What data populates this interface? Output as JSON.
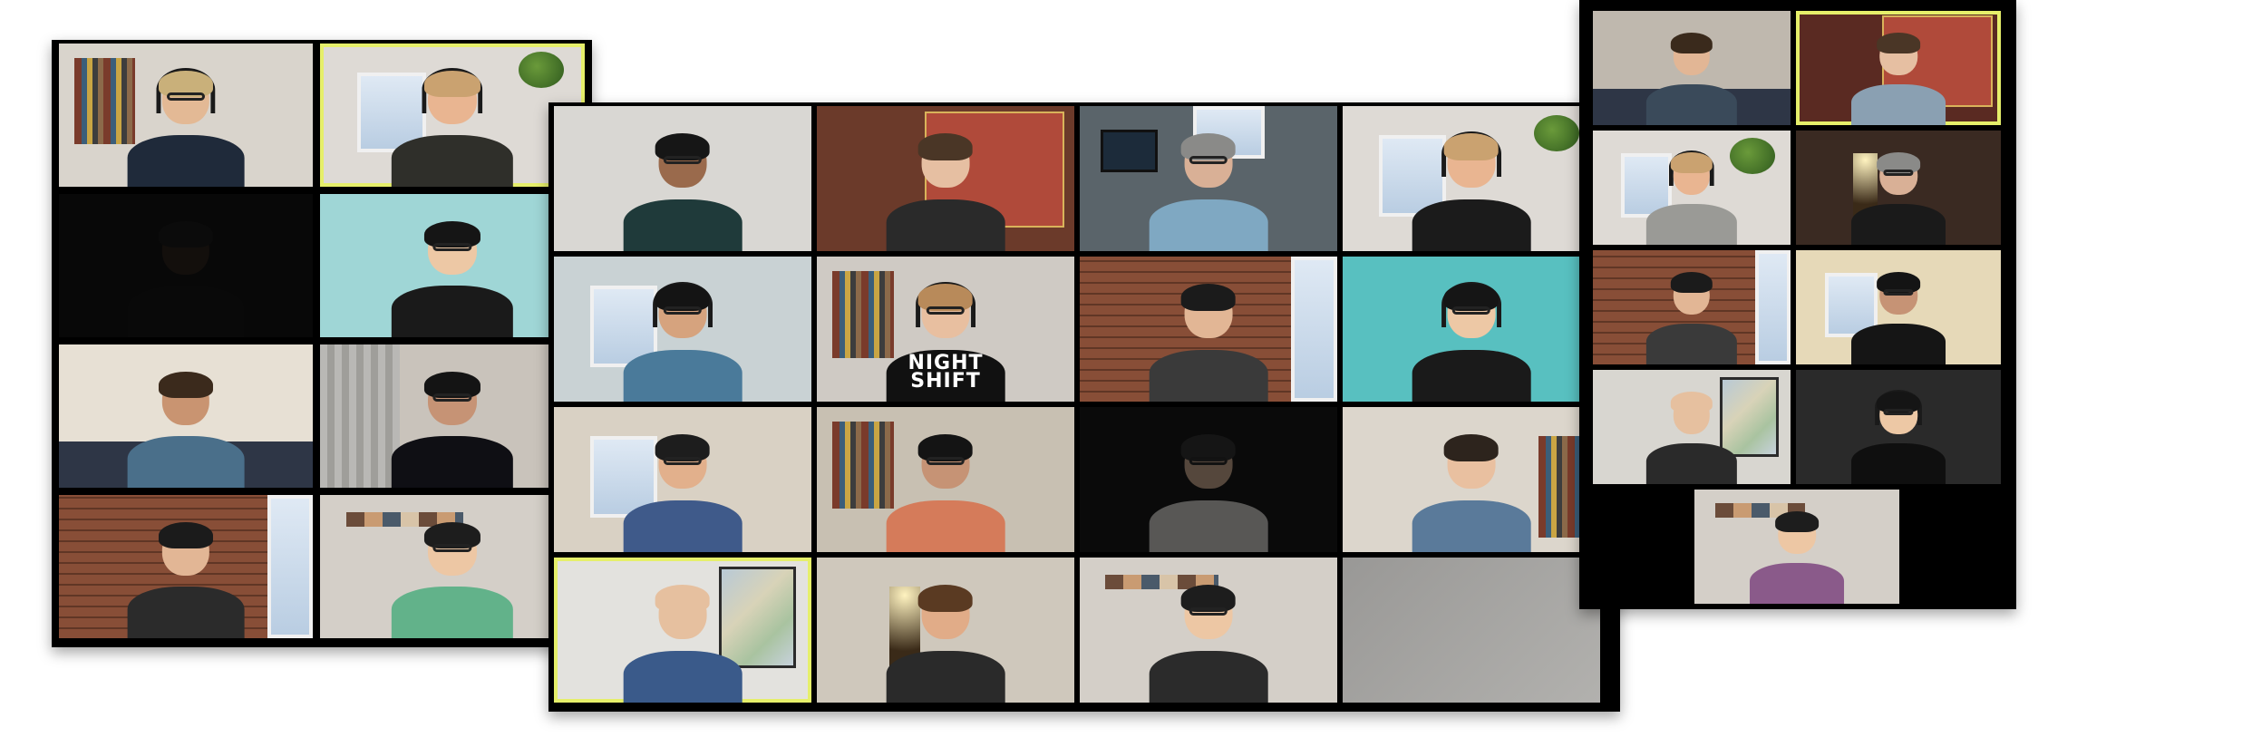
{
  "screen": {
    "background": "#ffffff"
  },
  "colors": {
    "window_bg": "#000000",
    "active_speaker_border": "#e6ef6a"
  },
  "windows": [
    {
      "name": "left-gallery",
      "tiles": [
        {
          "name": "participant-1",
          "bg": "#d9d4cc",
          "skin": "#e3b995",
          "hair": "#c9b07a",
          "shirt": "#1f2a3a",
          "glasses": true,
          "headset": true,
          "speaking": false,
          "scene": "room-shelf"
        },
        {
          "name": "participant-2",
          "bg": "#dedad5",
          "skin": "#e9b591",
          "hair": "#caa270",
          "shirt": "#2f2f2a",
          "glasses": false,
          "headset": true,
          "speaking": true,
          "scene": "window-plant"
        },
        {
          "name": "participant-3",
          "bg": "#080808",
          "skin": "#2a1c14",
          "hair": "#111111",
          "shirt": "#0c0c0c",
          "glasses": false,
          "headset": false,
          "speaking": false,
          "scene": "dark"
        },
        {
          "name": "participant-4",
          "bg": "#9fd6d6",
          "skin": "#edc8a5",
          "hair": "#151515",
          "shirt": "#1a1a1a",
          "glasses": true,
          "headset": false,
          "speaking": false,
          "scene": "plain"
        },
        {
          "name": "participant-5",
          "bg": "#e7e0d4",
          "skin": "#c99471",
          "hair": "#3b2a1c",
          "shirt": "#4a6f8a",
          "glasses": false,
          "headset": false,
          "speaking": false,
          "scene": "couch"
        },
        {
          "name": "participant-6",
          "bg": "#c9c3bb",
          "skin": "#c69375",
          "hair": "#141414",
          "shirt": "#0f0f14",
          "glasses": true,
          "headset": false,
          "speaking": false,
          "scene": "curtain"
        },
        {
          "name": "participant-7",
          "bg": "#7a4a34",
          "skin": "#e2b695",
          "hair": "#1b1b1b",
          "shirt": "#2b2b2b",
          "glasses": false,
          "headset": false,
          "speaking": false,
          "scene": "brick"
        },
        {
          "name": "participant-8",
          "bg": "#d4cfc8",
          "skin": "#edc7a4",
          "hair": "#1d1d1d",
          "shirt": "#62b28a",
          "glasses": true,
          "headset": false,
          "speaking": false,
          "scene": "photos"
        }
      ]
    },
    {
      "name": "center-gallery",
      "tiles": [
        {
          "name": "participant-9",
          "bg": "#d9d7d3",
          "skin": "#9a6a4c",
          "hair": "#161616",
          "shirt": "#1f3a3a",
          "glasses": true,
          "headset": false,
          "speaking": false,
          "scene": "plain"
        },
        {
          "name": "participant-10",
          "bg": "#6b3a2a",
          "skin": "#e6bfa2",
          "hair": "#4a3626",
          "shirt": "#2a2a2a",
          "glasses": false,
          "headset": false,
          "speaking": false,
          "scene": "poster"
        },
        {
          "name": "participant-11",
          "bg": "#5a646a",
          "skin": "#d9b096",
          "hair": "#8a8a88",
          "shirt": "#7fa8c2",
          "glasses": true,
          "headset": false,
          "speaking": false,
          "scene": "desk"
        },
        {
          "name": "participant-12",
          "bg": "#dedad5",
          "skin": "#e9b591",
          "hair": "#caa270",
          "shirt": "#1b1b1b",
          "glasses": false,
          "headset": true,
          "speaking": false,
          "scene": "window-plant"
        },
        {
          "name": "participant-13",
          "bg": "#c9d2d4",
          "skin": "#d6a37e",
          "hair": "#141414",
          "shirt": "#4a7a9a",
          "glasses": true,
          "headset": true,
          "speaking": false,
          "scene": "window"
        },
        {
          "name": "participant-14",
          "bg": "#cfcac4",
          "skin": "#e8bfa0",
          "hair": "#b88a5a",
          "shirt": "#111111",
          "glasses": true,
          "headset": true,
          "speaking": false,
          "scene": "room-shelf",
          "shirt_text": "NIGHT\nSHIFT"
        },
        {
          "name": "participant-15",
          "bg": "#7a4a34",
          "skin": "#e2b695",
          "hair": "#1b1b1b",
          "shirt": "#3a3a3a",
          "glasses": false,
          "headset": false,
          "speaking": false,
          "scene": "brick"
        },
        {
          "name": "participant-16",
          "bg": "#58c0c0",
          "skin": "#edc8a5",
          "hair": "#151515",
          "shirt": "#1a1a1a",
          "glasses": true,
          "headset": true,
          "speaking": false,
          "scene": "plain"
        },
        {
          "name": "participant-17",
          "bg": "#d9d1c4",
          "skin": "#e2b08c",
          "hair": "#1d1d1d",
          "shirt": "#3f5a8a",
          "glasses": true,
          "headset": false,
          "speaking": false,
          "scene": "window"
        },
        {
          "name": "participant-18",
          "bg": "#c8c0b2",
          "skin": "#c69375",
          "hair": "#141414",
          "shirt": "#d57b5a",
          "glasses": true,
          "headset": false,
          "speaking": false,
          "scene": "bookshelf"
        },
        {
          "name": "participant-19",
          "bg": "#0a0a0a",
          "skin": "#e0b999",
          "hair": "#2a2a2a",
          "shirt": "#e8e6e2",
          "glasses": true,
          "headset": false,
          "speaking": false,
          "scene": "dark"
        },
        {
          "name": "participant-20",
          "bg": "#dcd6cc",
          "skin": "#e9c0a0",
          "hair": "#2d241d",
          "shirt": "#5a7a9a",
          "glasses": false,
          "headset": false,
          "speaking": false,
          "scene": "bookshelf-right"
        },
        {
          "name": "participant-21",
          "bg": "#e3e2de",
          "skin": "#e6c09f",
          "hair": "#e6c09f",
          "shirt": "#3a5a8a",
          "glasses": false,
          "headset": false,
          "speaking": true,
          "scene": "map"
        },
        {
          "name": "participant-22",
          "bg": "#cfc8bc",
          "skin": "#e1ac88",
          "hair": "#5a3a22",
          "shirt": "#2a2a2a",
          "glasses": false,
          "headset": false,
          "speaking": false,
          "scene": "lamp"
        },
        {
          "name": "participant-23",
          "bg": "#d4cfc8",
          "skin": "#edc7a4",
          "hair": "#1d1d1d",
          "shirt": "#2b2b2b",
          "glasses": true,
          "headset": false,
          "speaking": false,
          "scene": "photos"
        },
        {
          "name": "participant-24",
          "bg": "#a6a5a2",
          "skin": "",
          "hair": "",
          "shirt": "",
          "glasses": false,
          "headset": false,
          "speaking": false,
          "scene": "blank"
        }
      ]
    },
    {
      "name": "right-gallery",
      "tiles": [
        {
          "name": "participant-25",
          "bg": "#bfb8ae",
          "skin": "#e2b695",
          "hair": "#3a2a1c",
          "shirt": "#3a4a5a",
          "glasses": false,
          "headset": false,
          "speaking": false,
          "scene": "couch"
        },
        {
          "name": "participant-26",
          "bg": "#5a2a22",
          "skin": "#e6bfa2",
          "hair": "#4a3626",
          "shirt": "#8aa0b2",
          "glasses": false,
          "headset": false,
          "speaking": true,
          "scene": "poster"
        },
        {
          "name": "participant-27",
          "bg": "#dedad5",
          "skin": "#e9b591",
          "hair": "#caa270",
          "shirt": "#9a9a96",
          "glasses": false,
          "headset": true,
          "speaking": false,
          "scene": "window-plant"
        },
        {
          "name": "participant-28",
          "bg": "#3a2a22",
          "skin": "#d9b096",
          "hair": "#8a8a88",
          "shirt": "#1a1a1a",
          "glasses": true,
          "headset": false,
          "speaking": false,
          "scene": "lamp"
        },
        {
          "name": "participant-29",
          "bg": "#7a4a34",
          "skin": "#e2b695",
          "hair": "#1b1b1b",
          "shirt": "#3a3a3a",
          "glasses": false,
          "headset": false,
          "speaking": false,
          "scene": "brick"
        },
        {
          "name": "participant-30",
          "bg": "#e6d9b8",
          "skin": "#c69375",
          "hair": "#141414",
          "shirt": "#151515",
          "glasses": true,
          "headset": false,
          "speaking": false,
          "scene": "window"
        },
        {
          "name": "participant-31",
          "bg": "#d8d6d0",
          "skin": "#e6c09f",
          "hair": "#e6c09f",
          "shirt": "#2a2a2a",
          "glasses": false,
          "headset": false,
          "speaking": false,
          "scene": "map"
        },
        {
          "name": "participant-32",
          "bg": "#2a2a2a",
          "skin": "#edc8a5",
          "hair": "#151515",
          "shirt": "#0f0f0f",
          "glasses": true,
          "headset": true,
          "speaking": false,
          "scene": "plain"
        },
        {
          "name": "participant-33",
          "bg": "#d4cfc8",
          "skin": "#edc7a4",
          "hair": "#1d1d1d",
          "shirt": "#8a5a8a",
          "glasses": false,
          "headset": false,
          "speaking": false,
          "scene": "photos"
        }
      ]
    }
  ]
}
